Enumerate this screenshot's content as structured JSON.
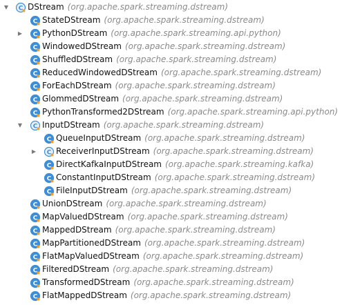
{
  "tree": {
    "items": [
      {
        "name": "DStream",
        "package": "(org.apache.spark.streaming.dstream)",
        "expanded": true,
        "has_children": true,
        "icon": "abstract-class-icon",
        "level": 0
      },
      {
        "name": "StateDStream",
        "package": "(org.apache.spark.streaming.dstream)",
        "expanded": false,
        "has_children": false,
        "icon": "class-icon",
        "level": 1
      },
      {
        "name": "PythonDStream",
        "package": "(org.apache.spark.streaming.api.python)",
        "expanded": false,
        "has_children": true,
        "icon": "class-icon",
        "level": 1
      },
      {
        "name": "WindowedDStream",
        "package": "(org.apache.spark.streaming.dstream)",
        "expanded": false,
        "has_children": false,
        "icon": "class-icon",
        "level": 1
      },
      {
        "name": "ShuffledDStream",
        "package": "(org.apache.spark.streaming.dstream)",
        "expanded": false,
        "has_children": false,
        "icon": "class-icon",
        "level": 1
      },
      {
        "name": "ReducedWindowedDStream",
        "package": "(org.apache.spark.streaming.dstream)",
        "expanded": false,
        "has_children": false,
        "icon": "class-icon",
        "level": 1
      },
      {
        "name": "ForEachDStream",
        "package": "(org.apache.spark.streaming.dstream)",
        "expanded": false,
        "has_children": false,
        "icon": "class-icon",
        "level": 1
      },
      {
        "name": "GlommedDStream",
        "package": "(org.apache.spark.streaming.dstream)",
        "expanded": false,
        "has_children": false,
        "icon": "class-icon",
        "level": 1
      },
      {
        "name": "PythonTransformed2DStream",
        "package": "(org.apache.spark.streaming.api.python)",
        "expanded": false,
        "has_children": false,
        "icon": "class-icon",
        "level": 1
      },
      {
        "name": "InputDStream",
        "package": "(org.apache.spark.streaming.dstream)",
        "expanded": true,
        "has_children": true,
        "icon": "abstract-class-icon",
        "level": 1
      },
      {
        "name": "QueueInputDStream",
        "package": "(org.apache.spark.streaming.dstream)",
        "expanded": false,
        "has_children": false,
        "icon": "class-icon",
        "level": 2
      },
      {
        "name": "ReceiverInputDStream",
        "package": "(org.apache.spark.streaming.dstream)",
        "expanded": false,
        "has_children": true,
        "icon": "abstract-class-icon",
        "level": 2
      },
      {
        "name": "DirectKafkaInputDStream",
        "package": "(org.apache.spark.streaming.kafka)",
        "expanded": false,
        "has_children": false,
        "icon": "class-icon",
        "level": 2
      },
      {
        "name": "ConstantInputDStream",
        "package": "(org.apache.spark.streaming.dstream)",
        "expanded": false,
        "has_children": false,
        "icon": "class-icon",
        "level": 2
      },
      {
        "name": "FileInputDStream",
        "package": "(org.apache.spark.streaming.dstream)",
        "expanded": false,
        "has_children": false,
        "icon": "class-icon",
        "level": 2
      },
      {
        "name": "UnionDStream",
        "package": "(org.apache.spark.streaming.dstream)",
        "expanded": false,
        "has_children": false,
        "icon": "class-icon",
        "level": 1
      },
      {
        "name": "MapValuedDStream",
        "package": "(org.apache.spark.streaming.dstream)",
        "expanded": false,
        "has_children": false,
        "icon": "class-icon",
        "level": 1
      },
      {
        "name": "MappedDStream",
        "package": "(org.apache.spark.streaming.dstream)",
        "expanded": false,
        "has_children": false,
        "icon": "class-icon",
        "level": 1
      },
      {
        "name": "MapPartitionedDStream",
        "package": "(org.apache.spark.streaming.dstream)",
        "expanded": false,
        "has_children": false,
        "icon": "class-icon",
        "level": 1
      },
      {
        "name": "FlatMapValuedDStream",
        "package": "(org.apache.spark.streaming.dstream)",
        "expanded": false,
        "has_children": false,
        "icon": "class-icon",
        "level": 1
      },
      {
        "name": "FilteredDStream",
        "package": "(org.apache.spark.streaming.dstream)",
        "expanded": false,
        "has_children": false,
        "icon": "class-icon",
        "level": 1
      },
      {
        "name": "TransformedDStream",
        "package": "(org.apache.spark.streaming.dstream)",
        "expanded": false,
        "has_children": false,
        "icon": "class-icon",
        "level": 1
      },
      {
        "name": "FlatMappedDStream",
        "package": "(org.apache.spark.streaming.dstream)",
        "expanded": false,
        "has_children": false,
        "icon": "class-icon",
        "level": 1
      }
    ],
    "colors": {
      "class_icon_fill": "#3d8ed6",
      "class_icon_letter": "#ffffff",
      "abstract_icon_fill": "#e4eef8",
      "toggle": "#7a7a7a",
      "package_text": "#8a8a8a"
    }
  }
}
